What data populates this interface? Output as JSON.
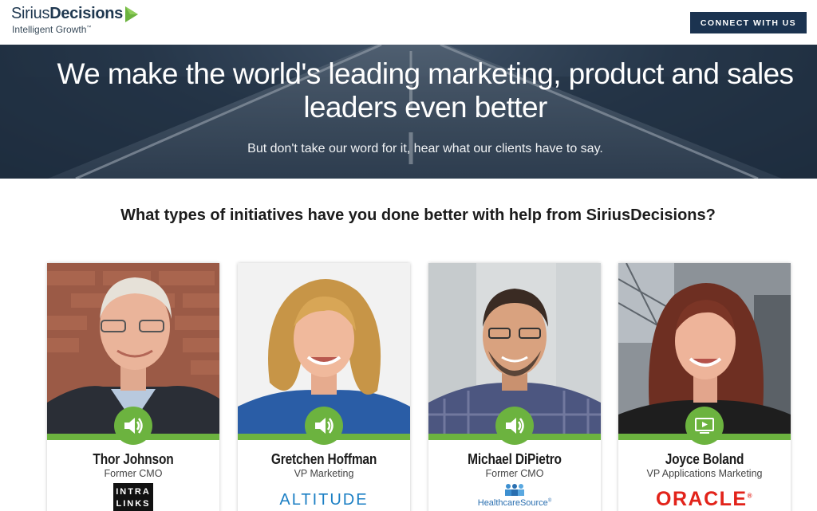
{
  "header": {
    "logo_text_light": "Sirius",
    "logo_text_bold": "Decisions",
    "logo_tagline": "Intelligent Growth",
    "logo_tm": "™",
    "cta_label": "CONNECT WITH US",
    "colors": {
      "navy": "#1b3350",
      "accent_green": "#6cb33f"
    }
  },
  "hero": {
    "title_line1": "We make the world's leading marketing, product and sales",
    "title_line2": "leaders even better",
    "subtitle": "But don't take our word for it, hear what our clients have to say."
  },
  "question": "What types of initiatives have you done better with help from SiriusDecisions?",
  "testimonials": [
    {
      "name": "Thor Johnson",
      "role": "Former CMO",
      "company_line1": "INTRA",
      "company_line2": "LINKS",
      "media_icon": "speaker-icon"
    },
    {
      "name": "Gretchen Hoffman",
      "role": "VP Marketing",
      "company": "ALTITUDE",
      "media_icon": "speaker-icon"
    },
    {
      "name": "Michael DiPietro",
      "role": "Former CMO",
      "company": "HealthcareSource",
      "company_mark": "®",
      "media_icon": "speaker-icon"
    },
    {
      "name": "Joyce Boland",
      "role": "VP Applications Marketing",
      "company": "ORACLE",
      "company_mark": "®",
      "media_icon": "video-play-icon"
    }
  ]
}
